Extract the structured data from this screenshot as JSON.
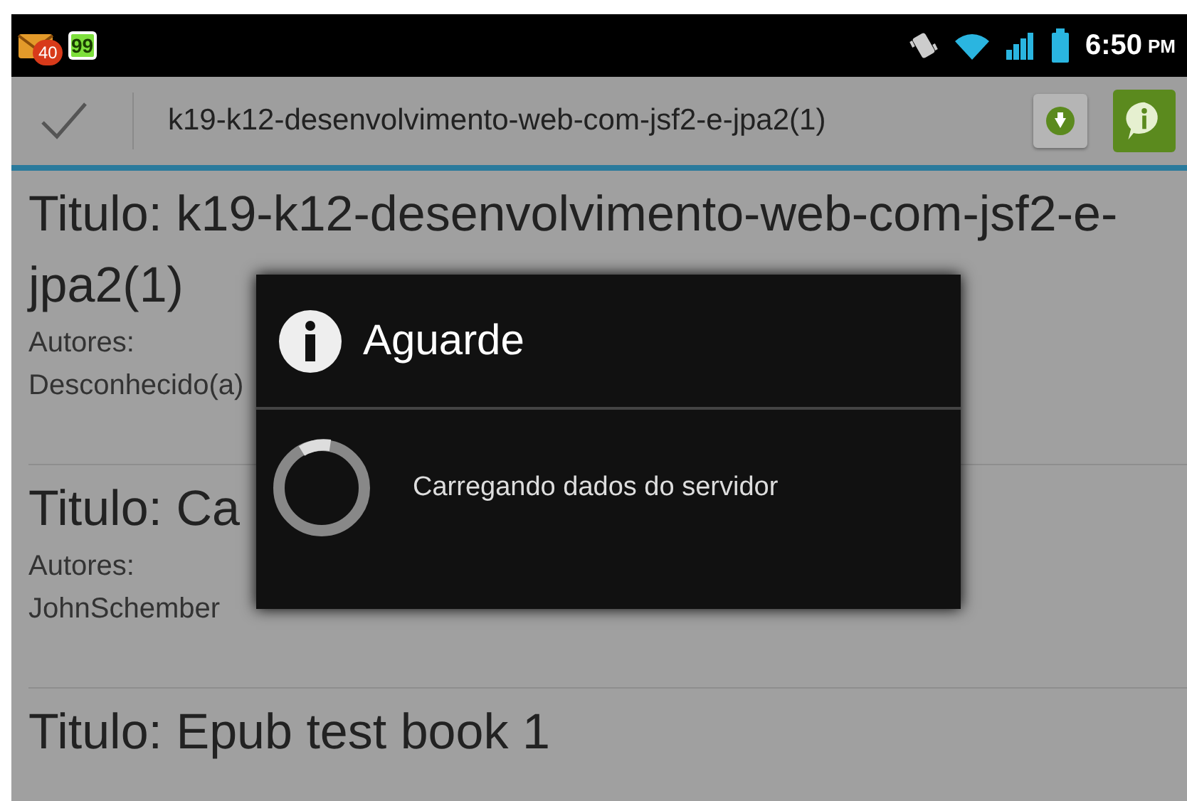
{
  "status_bar": {
    "notification_count": "40",
    "battery_widget": "99",
    "time": "6:50",
    "time_suffix": "PM"
  },
  "action_bar": {
    "title": "k19-k12-desenvolvimento-web-com-jsf2-e-jpa2(1)"
  },
  "books": [
    {
      "title": "Titulo: k19-k12-desenvolvimento-web-com-jsf2-e-jpa2(1)",
      "authors_label": "Autores:",
      "authors": "Desconhecido(a)"
    },
    {
      "title": "Titulo: Ca",
      "authors_label": "Autores:",
      "authors": "JohnSchember"
    },
    {
      "title": "Titulo: Epub test book 1"
    }
  ],
  "dialog": {
    "title": "Aguarde",
    "message": "Carregando dados do servidor"
  }
}
